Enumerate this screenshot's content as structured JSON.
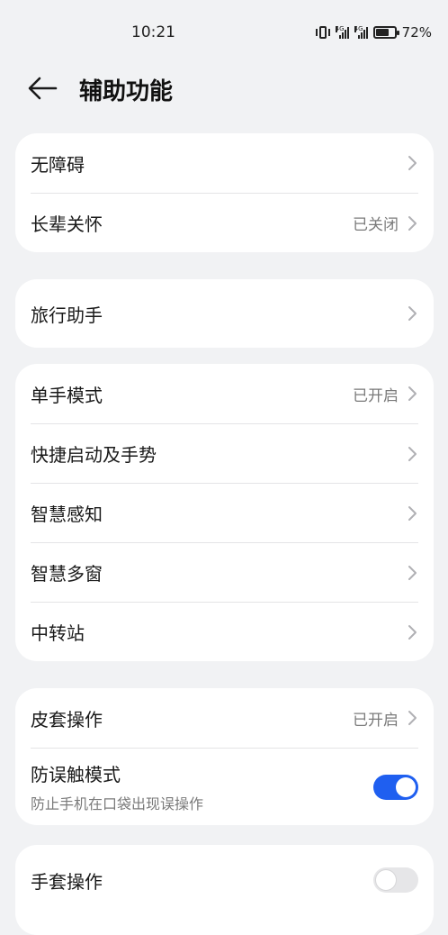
{
  "status_bar": {
    "time": "10:21",
    "network_1": "4G",
    "network_2": "4G",
    "battery_percent": "72%",
    "battery_level": 0.72
  },
  "header": {
    "title": "辅助功能"
  },
  "groups": [
    {
      "items": [
        {
          "label": "无障碍",
          "value": ""
        },
        {
          "label": "长辈关怀",
          "value": "已关闭"
        }
      ]
    },
    {
      "items": [
        {
          "label": "旅行助手",
          "value": ""
        }
      ]
    },
    {
      "items": [
        {
          "label": "单手模式",
          "value": "已开启"
        },
        {
          "label": "快捷启动及手势",
          "value": ""
        },
        {
          "label": "智慧感知",
          "value": ""
        },
        {
          "label": "智慧多窗",
          "value": ""
        },
        {
          "label": "中转站",
          "value": ""
        }
      ]
    },
    {
      "items": [
        {
          "label": "皮套操作",
          "value": "已开启"
        },
        {
          "label": "防误触模式",
          "subtitle": "防止手机在口袋出现误操作",
          "toggle": true
        }
      ]
    },
    {
      "items": [
        {
          "label": "手套操作",
          "toggle": false
        }
      ]
    }
  ],
  "colors": {
    "accent": "#1f5ff0",
    "background": "#f1f2f4"
  }
}
